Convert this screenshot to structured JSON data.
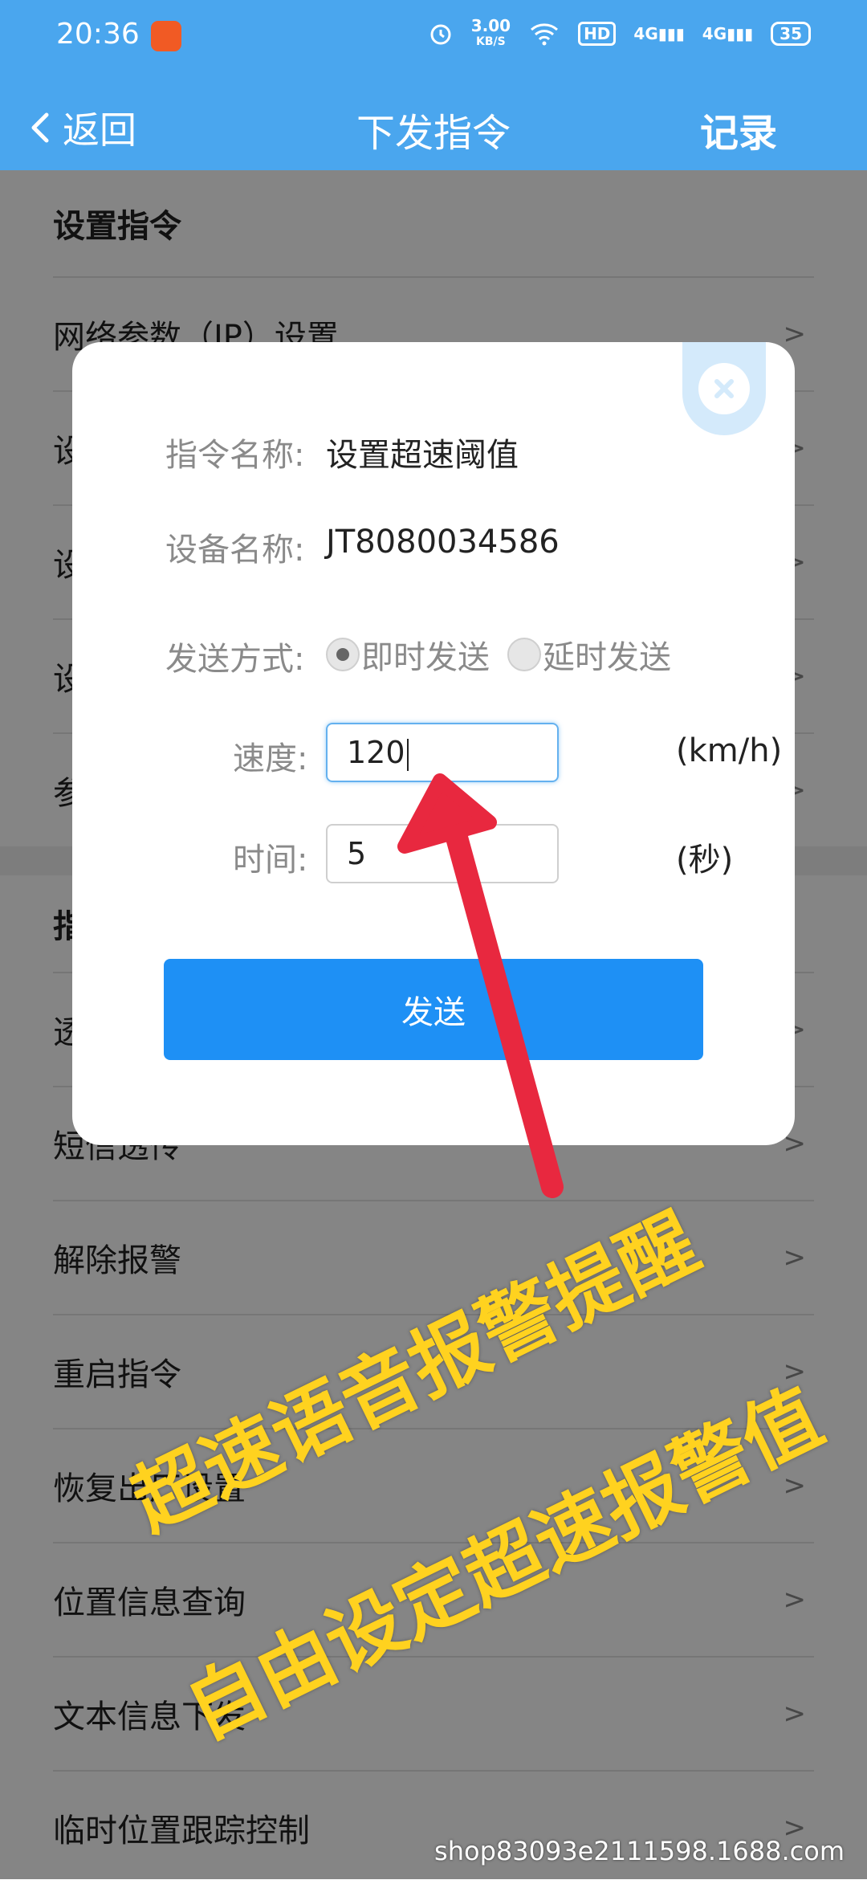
{
  "status_bar": {
    "time": "20:36",
    "net_speed": "3.00",
    "net_speed_unit": "KB/S",
    "hd_badge": "HD",
    "signal1": "4G",
    "signal2": "4G",
    "battery": "35"
  },
  "nav": {
    "back_label": "返回",
    "title": "下发指令",
    "record_label": "记录"
  },
  "list": {
    "section_title": "设置指令",
    "items_top": [
      "网络参数（IP）设置",
      "设",
      "设",
      "设",
      "参"
    ],
    "section2_title": "指",
    "items_bottom": [
      "透",
      "短信透传",
      "解除报警",
      "重启指令",
      "恢复出厂设置",
      "位置信息查询",
      "文本信息下发",
      "临时位置跟踪控制"
    ]
  },
  "dialog": {
    "command_name_label": "指令名称:",
    "command_name_value": "设置超速阈值",
    "device_name_label": "设备名称:",
    "device_name_value": "JT8080034586",
    "send_mode_label": "发送方式:",
    "send_mode_options": [
      "即时发送",
      "延时发送"
    ],
    "send_mode_selected": "即时发送",
    "speed_label": "速度:",
    "speed_value": "120",
    "speed_unit": "(km/h)",
    "time_label": "时间:",
    "time_value": "5",
    "time_unit": "(秒)",
    "send_button": "发送"
  },
  "annotation": {
    "line1": "超速语音报警提醒",
    "line2": "自由设定超速报警值",
    "arrow_color": "#e8283f",
    "text_color": "#ffd21f"
  },
  "watermark": "shop83093e2111598.1688.com",
  "colors": {
    "header": "#4aa6ee",
    "send_button": "#1e90f5"
  }
}
